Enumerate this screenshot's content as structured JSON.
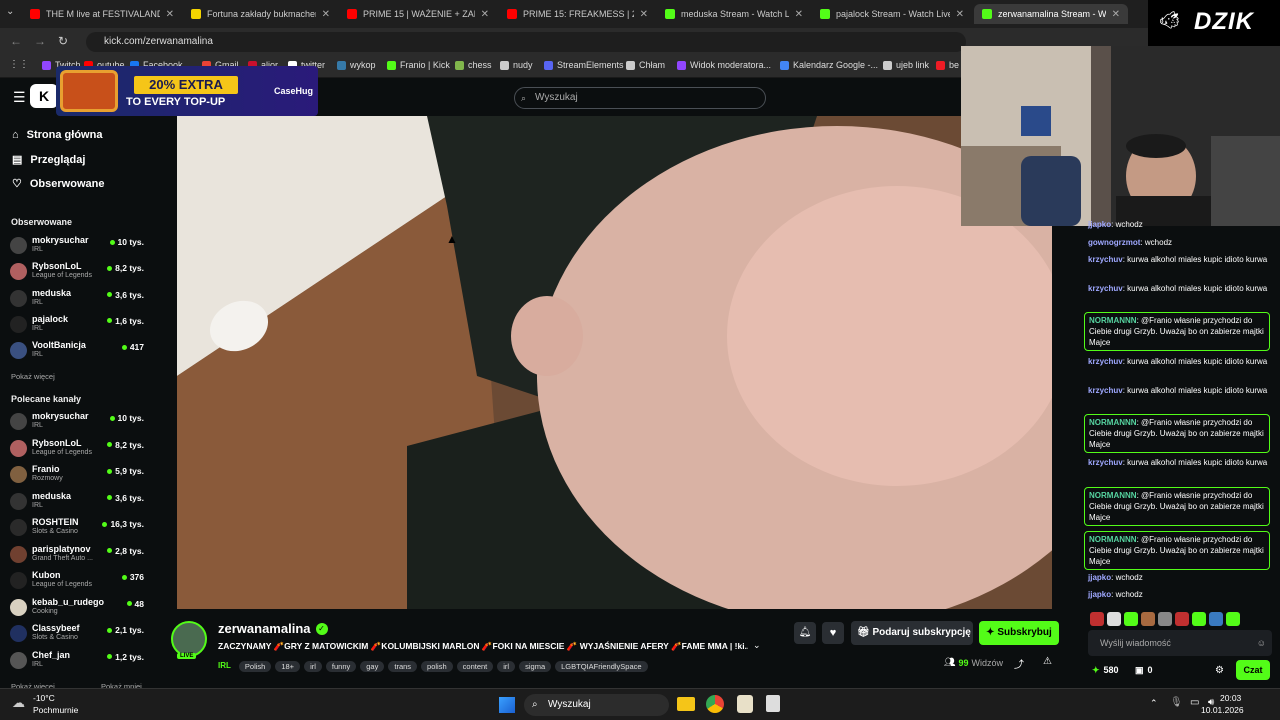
{
  "browser": {
    "tabs": [
      {
        "label": "THE M live at FESTIVALAND 20",
        "color": "#ff0000"
      },
      {
        "label": "Fortuna zakłady bukmacherskie",
        "color": "#f5d400"
      },
      {
        "label": "PRIME 15 | WAŻENIE + ZADYM",
        "color": "#ff0000"
      },
      {
        "label": "PRIME 15: FREAKMESS | 24H PR",
        "color": "#ff0000"
      },
      {
        "label": "meduska Stream - Watch Li",
        "color": "#53fc18"
      },
      {
        "label": "pajalock Stream - Watch Live o",
        "color": "#53fc18"
      },
      {
        "label": "zerwanamalina Stream - W",
        "color": "#53fc18"
      }
    ],
    "url": "kick.com/zerwanamalina",
    "bookmarks": [
      {
        "label": "Twitch",
        "color": "#9146ff"
      },
      {
        "label": "outube",
        "color": "#ff0000"
      },
      {
        "label": "Facebook",
        "color": "#1877f2"
      },
      {
        "label": "Gmail",
        "color": "#ea4335"
      },
      {
        "label": "alior",
        "color": "#c8102e"
      },
      {
        "label": "twitter",
        "color": "#ffffff"
      },
      {
        "label": "wykop",
        "color": "#367aa9"
      },
      {
        "label": "Franio | Kick",
        "color": "#53fc18"
      },
      {
        "label": "chess",
        "color": "#81b64c"
      },
      {
        "label": "nudy",
        "color": "#cccccc"
      },
      {
        "label": "StreamElements",
        "color": "#5865f2"
      },
      {
        "label": "Chłam",
        "color": "#cccccc"
      },
      {
        "label": "Widok moderatora...",
        "color": "#9146ff"
      },
      {
        "label": "Kalendarz Google -...",
        "color": "#4285f4"
      },
      {
        "label": "ujeb link",
        "color": "#cccccc"
      },
      {
        "label": "be",
        "color": "#ee1c25"
      }
    ]
  },
  "ad": {
    "line1": "20% EXTRA",
    "line2": "TO EVERY TOP-UP",
    "brand": "CaseHug"
  },
  "kick": {
    "search_placeholder": "Wyszukaj"
  },
  "sidebar": {
    "nav": [
      "Strona główna",
      "Przeglądaj",
      "Obserwowane"
    ],
    "followed_title": "Obserwowane",
    "followed": [
      {
        "name": "mokrysuchar",
        "cat": "IRL",
        "viewers": "10 tys.",
        "color": "#444"
      },
      {
        "name": "RybsonLoL",
        "cat": "League of Legends",
        "viewers": "8,2 tys.",
        "color": "#b06060"
      },
      {
        "name": "meduska",
        "cat": "IRL",
        "viewers": "3,6 tys.",
        "color": "#333"
      },
      {
        "name": "pajalock",
        "cat": "IRL",
        "viewers": "1,6 tys.",
        "color": "#222"
      },
      {
        "name": "VooltBanicja",
        "cat": "IRL",
        "viewers": "417",
        "color": "#3a5080"
      }
    ],
    "show_more": "Pokaż więcej",
    "recommended_title": "Polecane kanały",
    "recommended": [
      {
        "name": "mokrysuchar",
        "cat": "IRL",
        "viewers": "10 tys.",
        "color": "#444"
      },
      {
        "name": "RybsonLoL",
        "cat": "League of Legends",
        "viewers": "8,2 tys.",
        "color": "#b06060"
      },
      {
        "name": "Franio",
        "cat": "Rozmowy",
        "viewers": "5,9 tys.",
        "color": "#806040"
      },
      {
        "name": "meduska",
        "cat": "IRL",
        "viewers": "3,6 tys.",
        "color": "#333"
      },
      {
        "name": "ROSHTEIN",
        "cat": "Slots & Casino",
        "viewers": "16,3 tys.",
        "color": "#2a2a2a"
      },
      {
        "name": "parisplatynov",
        "cat": "Grand Theft Auto ...",
        "viewers": "2,8 tys.",
        "color": "#704030"
      },
      {
        "name": "Kubon",
        "cat": "League of Legends",
        "viewers": "376",
        "color": "#222"
      },
      {
        "name": "kebab_u_rudego",
        "cat": "Cooking",
        "viewers": "48",
        "color": "#d8d0c0"
      },
      {
        "name": "Classybeef",
        "cat": "Slots & Casino",
        "viewers": "2,1 tys.",
        "color": "#203060"
      },
      {
        "name": "Chef_jan",
        "cat": "IRL",
        "viewers": "1,2 tys.",
        "color": "#555"
      }
    ],
    "show_more2": "Pokaż więcej",
    "show_less": "Pokaż mniej"
  },
  "stream": {
    "name": "zerwanamalina",
    "title": "ZACZYNAMY 🧨GRY Z MATOWICKIM 🧨KOLUMBIJSKI MARLON 🧨FOKI NA MIESCIE 🧨 WYJAŚNIENIE AFERY 🧨FAME MMA | !ki...",
    "live": "LIVE",
    "category": "IRL",
    "tags": [
      "Polish",
      "18+",
      "irl",
      "funny",
      "gay",
      "trans",
      "polish",
      "content",
      "irl",
      "sigma",
      "LGBTQIAFriendlySpace"
    ],
    "viewers": "99",
    "viewers_label": "Widzów",
    "gift_label": "Podaruj subskrypcję",
    "sub_label": "Subskrybuj"
  },
  "chat": {
    "messages": [
      {
        "user": "jjapko",
        "text": "wchodz",
        "color": "#9fa8ff",
        "hl": false
      },
      {
        "user": "gownogrzmot",
        "text": "wchodz",
        "color": "#9fa8ff",
        "hl": false
      },
      {
        "user": "krzychuv",
        "text": "kurwa alkohol miales kupic idioto kurwa",
        "color": "#9fa8ff",
        "hl": false
      },
      {
        "user": "krzychuv",
        "text": "kurwa alkohol miales kupic idioto kurwa",
        "color": "#9fa8ff",
        "hl": false
      },
      {
        "user": "NORMANNN",
        "text": "@Franio własnie przychodzi do Ciebie drugi Grzyb. Uważaj bo on zabierze majtki Majce",
        "color": "#56d4a0",
        "hl": true
      },
      {
        "user": "krzychuv",
        "text": "kurwa alkohol miales kupic idioto kurwa",
        "color": "#9fa8ff",
        "hl": false
      },
      {
        "user": "krzychuv",
        "text": "kurwa alkohol miales kupic idioto kurwa",
        "color": "#9fa8ff",
        "hl": false
      },
      {
        "user": "NORMANNN",
        "text": "@Franio własnie przychodzi do Ciebie drugi Grzyb. Uważaj bo on zabierze majtki Majce",
        "color": "#56d4a0",
        "hl": true
      },
      {
        "user": "krzychuv",
        "text": "kurwa alkohol miales kupic idioto kurwa",
        "color": "#9fa8ff",
        "hl": false
      },
      {
        "user": "NORMANNN",
        "text": "@Franio własnie przychodzi do Ciebie drugi Grzyb. Uważaj bo on zabierze majtki Majce",
        "color": "#56d4a0",
        "hl": true
      },
      {
        "user": "NORMANNN",
        "text": "@Franio własnie przychodzi do Ciebie drugi Grzyb. Uważaj bo on zabierze majtki Majce",
        "color": "#56d4a0",
        "hl": true
      },
      {
        "user": "jjapko",
        "text": "wchodz",
        "color": "#9fa8ff",
        "hl": false
      },
      {
        "user": "jjapko",
        "text": "wchodz",
        "color": "#9fa8ff",
        "hl": false
      }
    ],
    "input_placeholder": "Wyślij wiadomość",
    "points": "580",
    "count2": "0",
    "send_label": "Czat"
  },
  "overlay": {
    "brand": "DZIK"
  },
  "taskbar": {
    "temp": "-10°C",
    "weather": "Pochmurnie",
    "search": "Wyszukaj",
    "time": "20:03",
    "date": "10.01.2026"
  }
}
